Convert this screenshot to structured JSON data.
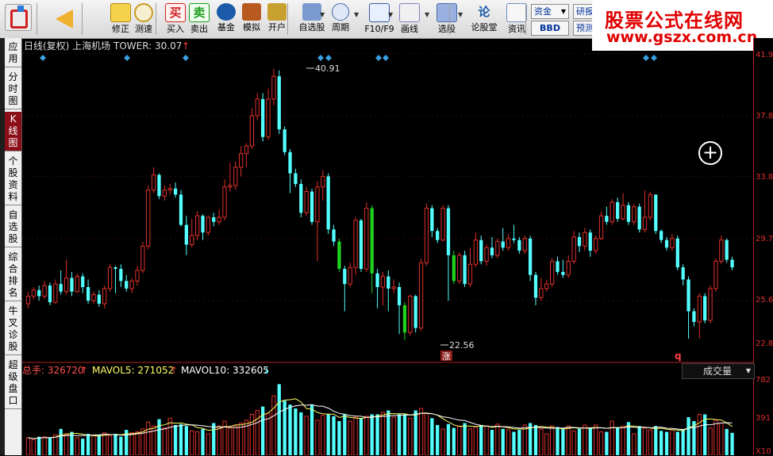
{
  "toolbar": {
    "items": [
      {
        "label": "修正",
        "icon": "arrow-up-down-icon"
      },
      {
        "label": "测速",
        "icon": "clock-icon"
      },
      {
        "label": "买入",
        "icon": "buy-icon",
        "glyph": "买"
      },
      {
        "label": "卖出",
        "icon": "sell-icon",
        "glyph": "卖"
      },
      {
        "label": "基金",
        "icon": "fund-icon"
      },
      {
        "label": "模拟",
        "icon": "hammer-icon"
      },
      {
        "label": "开户",
        "icon": "lock-icon"
      },
      {
        "label": "自选股",
        "icon": "star-folder-icon"
      },
      {
        "label": "周期",
        "icon": "period-icon"
      },
      {
        "label": "F10/F9",
        "icon": "f10-icon"
      },
      {
        "label": "画线",
        "icon": "pencil-icon"
      },
      {
        "label": "选股",
        "icon": "select-stock-icon"
      },
      {
        "label": "论股堂",
        "icon": "lun-icon",
        "glyph": "论"
      },
      {
        "label": "资讯",
        "icon": "news-icon"
      }
    ],
    "fund_select": "资金",
    "bbd_button": "BBD",
    "research_button": "研报",
    "preview_button": "预测"
  },
  "banner": {
    "line1": "股票公式在线网",
    "line2": "www.gszx.com.cn"
  },
  "sidebar": {
    "tabs": [
      "应用",
      "分时图",
      "K线图",
      "个股资料",
      "自选股",
      "综合排名",
      "牛叉诊股",
      "超级盘口"
    ],
    "active_index": 2
  },
  "chart_header": {
    "text": "日线(复权) 上海机场 TOWER: 30.07"
  },
  "volume_header": {
    "total_label": "总手: 326720",
    "mavol5_label": "MAVOL5: 271052",
    "mavol10_label": "MAVOL10: 332605"
  },
  "volume_dropdown": "成交量",
  "price_axis": {
    "labels": [
      "41.9",
      "37.8",
      "33.8",
      "29.7",
      "25.6",
      "22.8"
    ]
  },
  "volume_axis": {
    "labels": [
      "782",
      "391",
      "X10"
    ]
  },
  "annotations": {
    "high": "40.91",
    "low": "22.56",
    "badge": "涨",
    "marker": "q"
  },
  "colors": {
    "up": "#e0302a",
    "down": "#54ffff",
    "flat_down": "#1ed21e",
    "ma5": "#ffff66",
    "ma10": "#ffffff",
    "label_red": "#ff5050",
    "accent": "#c81e1e"
  },
  "chart_data": [
    {
      "type": "candlestick",
      "title": "日线(复权) 上海机场",
      "ylim": [
        22.0,
        42.4
      ],
      "candles": [
        [
          25.4,
          25.9,
          25.1,
          26.2
        ],
        [
          25.9,
          26.3,
          25.7,
          26.5
        ],
        [
          26.3,
          25.9,
          25.6,
          26.6
        ],
        [
          25.9,
          26.6,
          25.7,
          26.9
        ],
        [
          26.6,
          25.5,
          25.3,
          26.8
        ],
        [
          25.5,
          26.7,
          25.4,
          27.0
        ],
        [
          26.7,
          26.2,
          26.0,
          27.6
        ],
        [
          26.2,
          27.1,
          26.0,
          28.3
        ],
        [
          27.1,
          26.2,
          25.9,
          27.5
        ],
        [
          26.2,
          27.2,
          26.1,
          27.4
        ],
        [
          27.2,
          26.5,
          26.1,
          27.4
        ],
        [
          26.5,
          25.6,
          25.4,
          27.0
        ],
        [
          25.6,
          26.0,
          25.4,
          26.2
        ],
        [
          26.0,
          25.4,
          25.2,
          26.3
        ],
        [
          25.4,
          26.4,
          25.1,
          26.6
        ],
        [
          26.4,
          27.8,
          26.2,
          28.0
        ],
        [
          27.8,
          27.7,
          26.1,
          27.9
        ],
        [
          27.7,
          26.9,
          26.5,
          28.0
        ],
        [
          26.9,
          26.4,
          26.2,
          27.3
        ],
        [
          26.4,
          26.9,
          26.1,
          27.1
        ],
        [
          26.9,
          27.6,
          26.6,
          27.9
        ],
        [
          27.6,
          29.2,
          27.4,
          29.5
        ],
        [
          29.2,
          32.9,
          29.0,
          33.2
        ],
        [
          32.9,
          33.9,
          32.7,
          34.4
        ],
        [
          33.9,
          32.5,
          32.3,
          34.0
        ],
        [
          32.5,
          32.9,
          32.2,
          33.2
        ],
        [
          32.9,
          33.0,
          32.6,
          33.3
        ],
        [
          33.0,
          32.6,
          32.4,
          33.4
        ],
        [
          32.6,
          30.6,
          30.5,
          32.9
        ],
        [
          30.6,
          29.3,
          28.6,
          31.2
        ],
        [
          29.3,
          29.9,
          29.1,
          31.0
        ],
        [
          29.9,
          31.2,
          29.6,
          31.5
        ],
        [
          31.2,
          30.1,
          29.6,
          31.3
        ],
        [
          30.1,
          31.1,
          29.9,
          31.2
        ],
        [
          31.1,
          30.8,
          30.5,
          31.4
        ],
        [
          30.8,
          31.1,
          30.6,
          31.6
        ],
        [
          31.1,
          33.1,
          30.9,
          33.6
        ],
        [
          33.1,
          33.2,
          32.8,
          34.7
        ],
        [
          33.2,
          34.4,
          32.9,
          34.8
        ],
        [
          34.4,
          35.3,
          33.8,
          35.8
        ],
        [
          35.3,
          35.8,
          34.4,
          36.0
        ],
        [
          35.8,
          37.8,
          35.6,
          38.3
        ],
        [
          37.8,
          38.9,
          37.5,
          39.3
        ],
        [
          38.9,
          36.4,
          36.1,
          39.3
        ],
        [
          36.4,
          38.9,
          36.2,
          39.6
        ],
        [
          38.9,
          40.4,
          38.5,
          40.9
        ],
        [
          40.4,
          36.9,
          36.6,
          40.8
        ],
        [
          36.9,
          35.4,
          35.2,
          37.1
        ],
        [
          35.4,
          34.0,
          32.7,
          35.6
        ],
        [
          34.0,
          33.3,
          33.1,
          34.3
        ],
        [
          33.3,
          31.4,
          31.1,
          33.6
        ],
        [
          31.4,
          32.8,
          31.2,
          33.1
        ],
        [
          32.8,
          30.8,
          30.6,
          33.0
        ],
        [
          30.8,
          33.1,
          28.2,
          33.5
        ],
        [
          33.1,
          33.8,
          32.2,
          34.2
        ],
        [
          33.8,
          30.3,
          30.0,
          34.0
        ],
        [
          30.3,
          29.5,
          29.2,
          30.6
        ],
        [
          29.5,
          27.7,
          27.5,
          29.7
        ],
        [
          27.7,
          26.7,
          24.9,
          27.9
        ],
        [
          26.7,
          27.8,
          26.5,
          28.1
        ],
        [
          27.8,
          30.9,
          27.3,
          31.1
        ],
        [
          30.9,
          27.7,
          27.5,
          31.0
        ],
        [
          27.7,
          31.7,
          27.5,
          32.1
        ],
        [
          31.7,
          27.4,
          26.1,
          31.9
        ],
        [
          27.4,
          26.5,
          25.1,
          27.7
        ],
        [
          26.5,
          27.2,
          25.3,
          27.5
        ],
        [
          27.2,
          26.4,
          24.9,
          27.6
        ],
        [
          26.4,
          26.5,
          26.1,
          27.0
        ],
        [
          26.5,
          25.3,
          23.4,
          26.8
        ],
        [
          25.3,
          23.5,
          23.0,
          25.5
        ],
        [
          23.5,
          25.9,
          23.3,
          26.0
        ],
        [
          25.9,
          23.8,
          23.5,
          26.0
        ],
        [
          23.8,
          28.1,
          23.6,
          28.4
        ],
        [
          28.1,
          31.7,
          27.9,
          32.0
        ],
        [
          31.7,
          30.2,
          29.8,
          31.9
        ],
        [
          30.2,
          29.6,
          29.4,
          30.4
        ],
        [
          29.6,
          31.7,
          29.5,
          31.9
        ],
        [
          31.7,
          28.6,
          25.6,
          31.9
        ],
        [
          28.6,
          26.9,
          26.7,
          28.9
        ],
        [
          26.9,
          28.6,
          26.7,
          28.8
        ],
        [
          28.6,
          26.7,
          26.5,
          28.9
        ],
        [
          26.7,
          28.0,
          26.5,
          29.1
        ],
        [
          28.0,
          29.6,
          27.8,
          30.1
        ],
        [
          29.6,
          28.2,
          28.0,
          29.9
        ],
        [
          28.2,
          29.1,
          27.9,
          29.3
        ],
        [
          29.1,
          28.6,
          28.4,
          29.8
        ],
        [
          28.6,
          29.5,
          28.4,
          29.7
        ],
        [
          29.5,
          29.1,
          28.9,
          30.4
        ],
        [
          29.1,
          29.7,
          28.9,
          30.0
        ],
        [
          29.7,
          29.6,
          29.4,
          30.6
        ],
        [
          29.6,
          28.9,
          28.7,
          29.8
        ],
        [
          28.9,
          29.7,
          28.7,
          29.9
        ],
        [
          29.7,
          27.3,
          26.9,
          29.9
        ],
        [
          27.3,
          25.8,
          25.3,
          27.5
        ],
        [
          25.8,
          26.4,
          25.6,
          27.1
        ],
        [
          26.4,
          26.7,
          26.2,
          27.0
        ],
        [
          26.7,
          28.2,
          26.5,
          28.4
        ],
        [
          28.2,
          27.5,
          27.3,
          28.5
        ],
        [
          27.5,
          27.3,
          27.1,
          28.3
        ],
        [
          27.3,
          28.2,
          27.1,
          28.6
        ],
        [
          28.2,
          29.8,
          28.0,
          30.2
        ],
        [
          29.8,
          29.2,
          28.8,
          30.1
        ],
        [
          29.2,
          30.1,
          28.9,
          30.4
        ],
        [
          30.1,
          28.9,
          28.5,
          30.3
        ],
        [
          28.9,
          29.7,
          28.7,
          29.9
        ],
        [
          29.7,
          31.2,
          29.6,
          31.5
        ],
        [
          31.2,
          30.8,
          30.6,
          31.8
        ],
        [
          30.8,
          32.1,
          30.6,
          32.3
        ],
        [
          32.1,
          31.0,
          30.8,
          32.4
        ],
        [
          31.0,
          31.9,
          30.9,
          32.7
        ],
        [
          31.9,
          30.8,
          30.6,
          32.1
        ],
        [
          30.8,
          31.8,
          30.6,
          32.0
        ],
        [
          31.8,
          30.3,
          30.1,
          32.0
        ],
        [
          30.3,
          31.1,
          30.1,
          32.9
        ],
        [
          31.1,
          32.6,
          30.9,
          32.8
        ],
        [
          32.6,
          30.2,
          30.0,
          32.6
        ],
        [
          30.2,
          29.6,
          29.4,
          30.3
        ],
        [
          29.6,
          29.1,
          28.9,
          29.8
        ],
        [
          29.1,
          29.7,
          28.9,
          30.0
        ],
        [
          29.7,
          27.8,
          27.6,
          29.9
        ],
        [
          27.8,
          27.0,
          26.6,
          28.0
        ],
        [
          27.0,
          24.9,
          23.1,
          27.2
        ],
        [
          24.9,
          24.2,
          23.9,
          25.1
        ],
        [
          24.2,
          25.9,
          23.1,
          26.1
        ],
        [
          25.9,
          24.3,
          24.1,
          26.1
        ],
        [
          24.3,
          26.4,
          24.1,
          26.6
        ],
        [
          26.4,
          28.2,
          26.2,
          28.4
        ],
        [
          28.2,
          29.6,
          28.0,
          29.9
        ],
        [
          29.6,
          28.3,
          28.1,
          29.7
        ],
        [
          28.3,
          27.8,
          27.6,
          28.5
        ]
      ]
    },
    {
      "type": "bar",
      "title": "总手",
      "ylim": [
        0,
        782
      ],
      "series": [
        {
          "name": "总手",
          "values": [
            180,
            160,
            190,
            190,
            180,
            210,
            270,
            220,
            240,
            180,
            170,
            220,
            200,
            210,
            230,
            200,
            220,
            190,
            260,
            230,
            240,
            270,
            340,
            300,
            370,
            280,
            380,
            310,
            320,
            300,
            250,
            240,
            270,
            220,
            330,
            300,
            350,
            280,
            300,
            330,
            360,
            420,
            460,
            500,
            430,
            610,
            730,
            560,
            520,
            480,
            440,
            400,
            520,
            360,
            410,
            420,
            400,
            350,
            420,
            350,
            390,
            380,
            400,
            420,
            420,
            440,
            460,
            390,
            420,
            420,
            380,
            460,
            480,
            430,
            380,
            310,
            270,
            320,
            280,
            300,
            330,
            270,
            290,
            310,
            300,
            260,
            320,
            270,
            260,
            240,
            260,
            310,
            330,
            310,
            270,
            220,
            300,
            290,
            270,
            300,
            250,
            270,
            310,
            280,
            310,
            240,
            240,
            350,
            280,
            300,
            340,
            220,
            300,
            280,
            260,
            300,
            250,
            240,
            260,
            240,
            270,
            390,
            350,
            420,
            420,
            280,
            360,
            330,
            270,
            230
          ]
        }
      ],
      "lines": [
        {
          "name": "MAVOL5",
          "values": "computed"
        },
        {
          "name": "MAVOL10",
          "values": "computed"
        }
      ]
    }
  ]
}
